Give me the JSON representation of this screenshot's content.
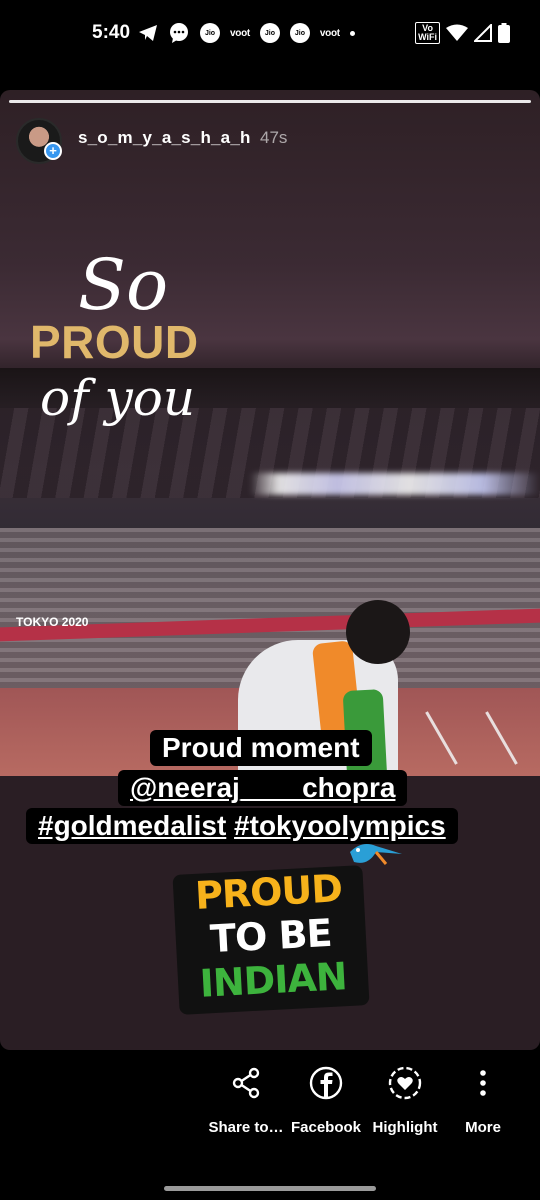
{
  "status_bar": {
    "time": "5:40",
    "left_icons": [
      "telegram-icon",
      "message-icon",
      "jio-icon",
      "voot-icon",
      "jio-icon",
      "jio-icon",
      "voot-icon",
      "more-dot-icon"
    ],
    "voot_label": "voot",
    "vowifi_label": "Vo WiFi",
    "right_icons": [
      "wifi-icon",
      "signal-icon",
      "battery-icon"
    ]
  },
  "story": {
    "username": "s_o_m_y_a_s_h_a_h",
    "time_ago": "47s",
    "headline_so": "So",
    "headline_proud": "PROUD",
    "headline_of_you": "of you",
    "banner_text": "TOKYO 2020",
    "caption_line1": "Proud moment",
    "caption_mention": "@neeraj____chopra",
    "caption_hashtag1": "#goldmedalist",
    "caption_hashtag2": "#tokyoolympics",
    "sticker_line1": "PROUD",
    "sticker_line2": "TO BE",
    "sticker_line3": "INDIAN"
  },
  "actions": [
    {
      "label": "Share to…",
      "icon": "share-icon"
    },
    {
      "label": "Facebook",
      "icon": "facebook-icon"
    },
    {
      "label": "Highlight",
      "icon": "highlight-heart-icon"
    },
    {
      "label": "More",
      "icon": "more-vertical-icon"
    }
  ],
  "colors": {
    "proud_gold": "#e0b86b",
    "sticker_orange": "#f7b21b",
    "sticker_green": "#3db33d",
    "avatar_add_blue": "#3897f0"
  }
}
